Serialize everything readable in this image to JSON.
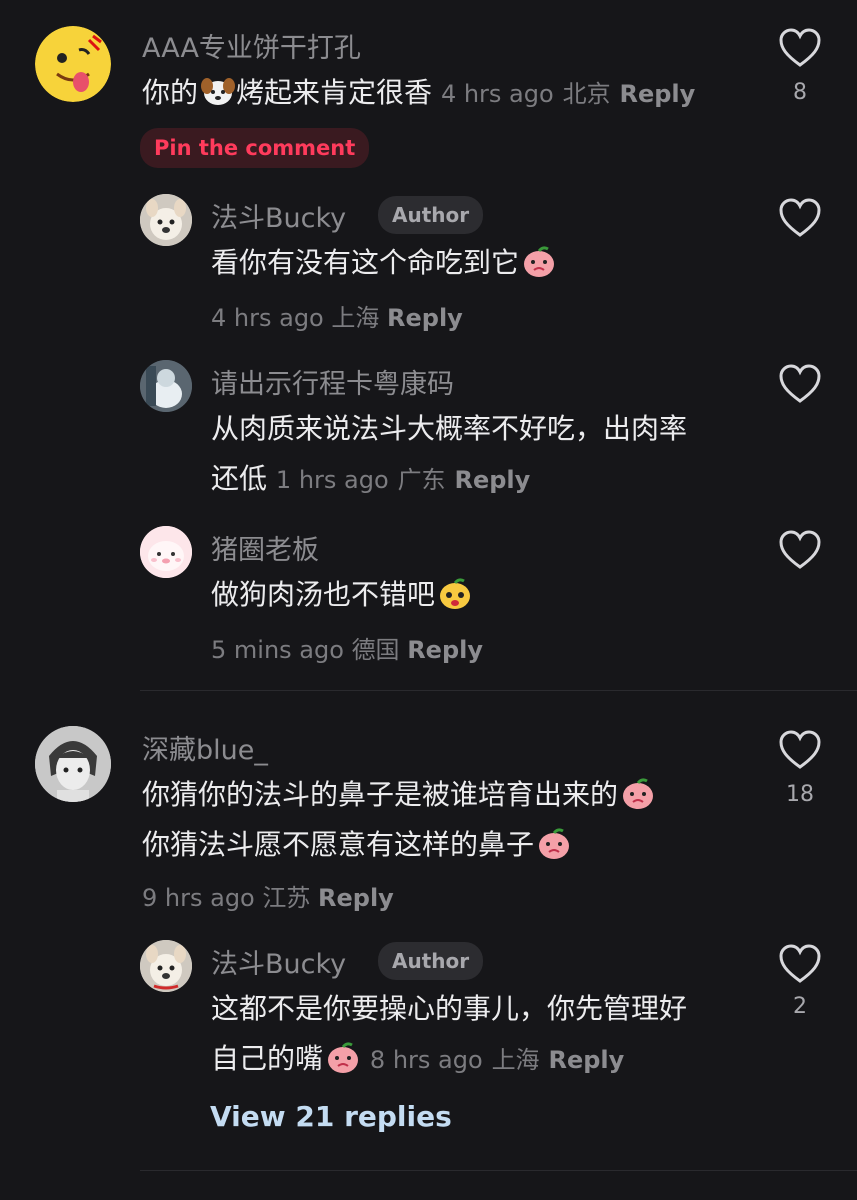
{
  "comments": [
    {
      "user": "AAA专业饼干打孔",
      "text": "你的🐶烤起来肯定很香",
      "time": "4 hrs ago",
      "location": "北京",
      "reply_label": "Reply",
      "likes": "8",
      "pin_label": "Pin the comment"
    },
    {
      "user": "法斗Bucky",
      "badge": "Author",
      "text": "看你有没有这个命吃到它",
      "time": "4 hrs ago",
      "location": "上海",
      "reply_label": "Reply"
    },
    {
      "user": "请出示行程卡粤康码",
      "text": "从肉质来说法斗大概率不好吃，出肉率还低",
      "line1": "从肉质来说法斗大概率不好吃，出肉率",
      "line2": "还低",
      "time": "1 hrs ago",
      "location": "广东",
      "reply_label": "Reply"
    },
    {
      "user": "猪圈老板",
      "text": "做狗肉汤也不错吧",
      "time": "5 mins ago",
      "location": "德国",
      "reply_label": "Reply"
    },
    {
      "user": "深藏blue_",
      "line1": "你猜你的法斗的鼻子是被谁培育出来的",
      "line2": "你猜法斗愿不愿意有这样的鼻子",
      "time": "9 hrs ago",
      "location": "江苏",
      "reply_label": "Reply",
      "likes": "18"
    },
    {
      "user": "法斗Bucky",
      "badge": "Author",
      "line1": "这都不是你要操心的事儿，你先管理好",
      "line2": "自己的嘴",
      "time": "8 hrs ago",
      "location": "上海",
      "reply_label": "Reply",
      "likes": "2"
    }
  ],
  "view_replies": "View 21 replies",
  "colors": {
    "background": "#161619",
    "pin": "#ff3b5c",
    "link": "#c4dcf2"
  },
  "icons": [
    "heart-outline-icon",
    "peach-emoji-icon",
    "dog-emoji-icon"
  ]
}
